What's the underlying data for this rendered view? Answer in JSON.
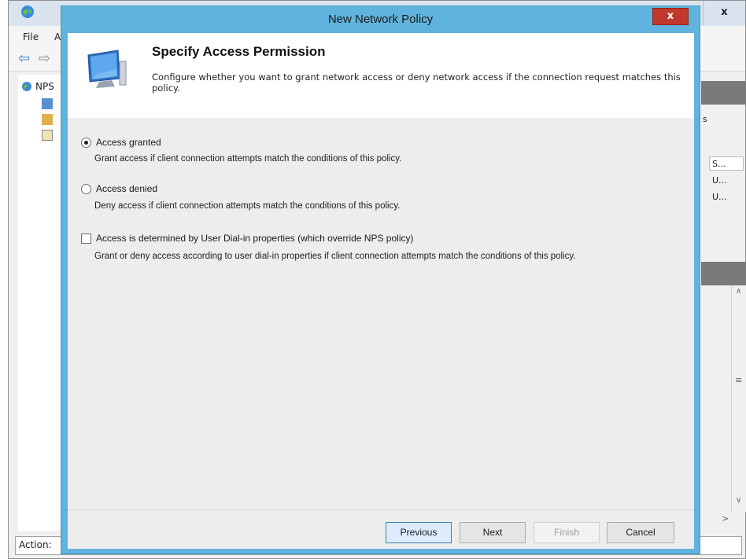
{
  "background_window": {
    "menu": {
      "file_label": "File",
      "action_initial": "A"
    },
    "tree": {
      "root_label": "NPS"
    },
    "right_pane": {
      "header_suffix": "s",
      "col_header": "S...",
      "rows": [
        "U...",
        "U..."
      ]
    },
    "close_glyph": "x",
    "statusbar_label": "Action:"
  },
  "dialog": {
    "title": "New Network Policy",
    "close_glyph": "x",
    "header": {
      "heading": "Specify Access Permission",
      "description": "Configure whether you want to grant network access or deny network access if the connection request matches this policy."
    },
    "options": [
      {
        "label": "Access granted",
        "description": "Grant access if client connection attempts match the conditions of this policy.",
        "checked": true
      },
      {
        "label": "Access denied",
        "description": "Deny access if client connection attempts match the conditions of this policy.",
        "checked": false
      }
    ],
    "dialin_option": {
      "label": "Access is determined by User Dial-in properties (which override NPS policy)",
      "description": "Grant or deny access according to user dial-in properties if client connection attempts match the conditions of this policy.",
      "checked": false
    },
    "buttons": {
      "previous": "Previous",
      "next": "Next",
      "finish": "Finish",
      "cancel": "Cancel"
    }
  },
  "colors": {
    "dialog_frame": "#5fb3dc",
    "close_button": "#c0392b",
    "client_bg": "#ededed"
  },
  "icons": [
    "globe-app-icon",
    "back-arrow-icon",
    "forward-arrow-icon",
    "monitor-icon",
    "close-icon"
  ]
}
